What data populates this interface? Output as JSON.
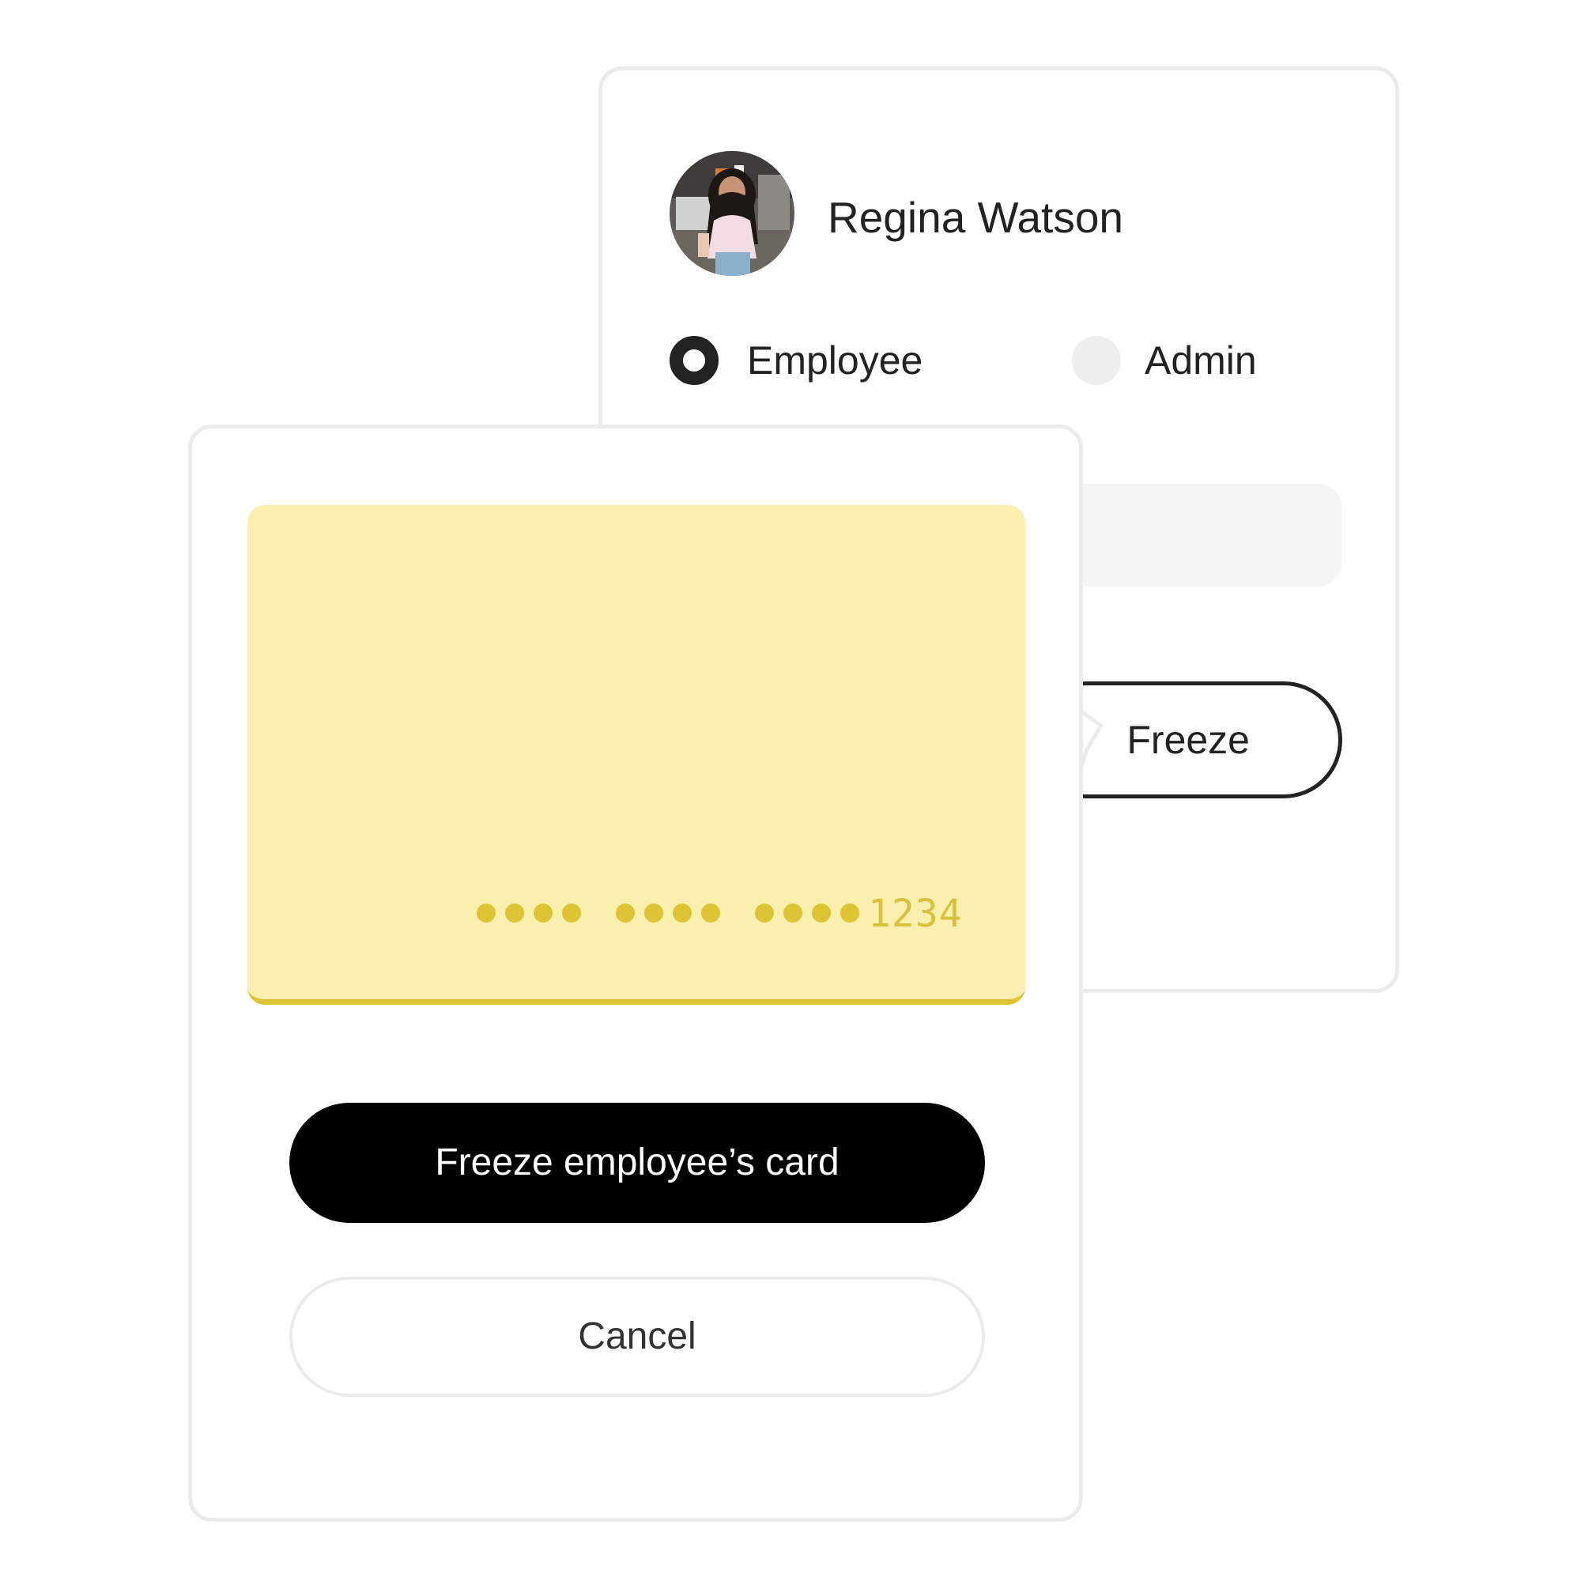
{
  "profile": {
    "name": "Regina Watson",
    "avatar_icon": "user-photo",
    "role_options": [
      {
        "label": "Employee",
        "selected": true
      },
      {
        "label": "Admin",
        "selected": false
      }
    ],
    "freeze_label": "Freeze"
  },
  "freeze_modal": {
    "card": {
      "masked_groups": 3,
      "last4": "1234",
      "color": "#faefad",
      "accent_color": "#dcc434"
    },
    "primary_label": "Freeze employee’s card",
    "cancel_label": "Cancel"
  }
}
